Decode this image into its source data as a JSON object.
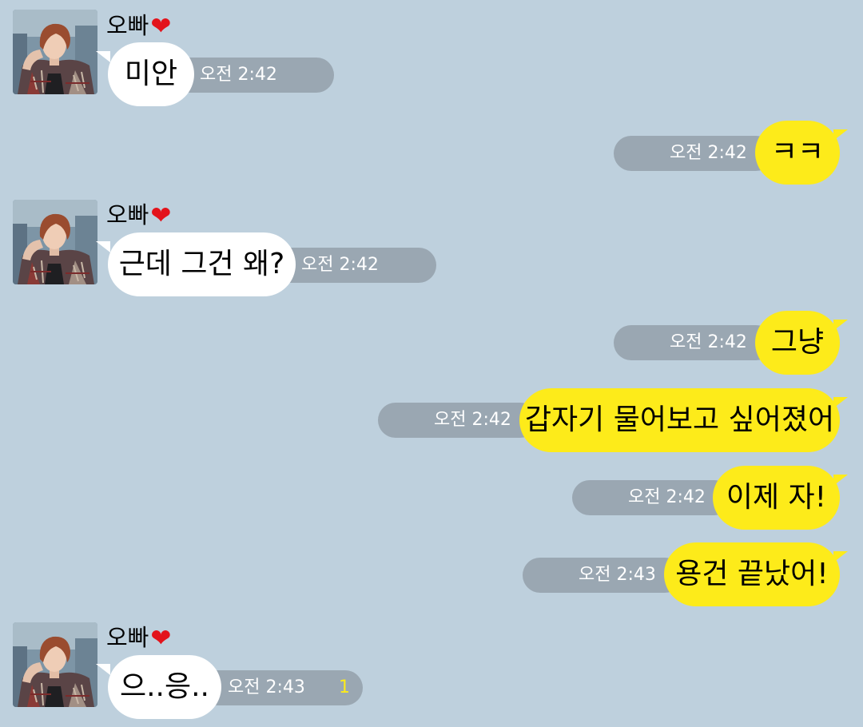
{
  "sender": {
    "name": "오빠",
    "heart_icon": "❤"
  },
  "colors": {
    "background": "#bed0dd",
    "incoming_bubble": "#ffffff",
    "outgoing_bubble": "#fdeb1a",
    "time_pill": "#9aa7b2",
    "unread_count": "#fdeb1a"
  },
  "messages": [
    {
      "direction": "in",
      "text": "미안",
      "time": "오전 2:42"
    },
    {
      "direction": "out",
      "text": "ㅋㅋ",
      "time": "오전 2:42"
    },
    {
      "direction": "in",
      "text": "근데 그건 왜?",
      "time": "오전 2:42"
    },
    {
      "direction": "out",
      "text": "그냥",
      "time": "오전 2:42"
    },
    {
      "direction": "out",
      "text": "갑자기 물어보고 싶어졌어",
      "time": "오전 2:42"
    },
    {
      "direction": "out",
      "text": "이제 자!",
      "time": "오전 2:42"
    },
    {
      "direction": "out",
      "text": "용건 끝났어!",
      "time": "오전 2:43"
    },
    {
      "direction": "in",
      "text": "으..응..",
      "time": "오전 2:43",
      "unread": "1"
    }
  ]
}
